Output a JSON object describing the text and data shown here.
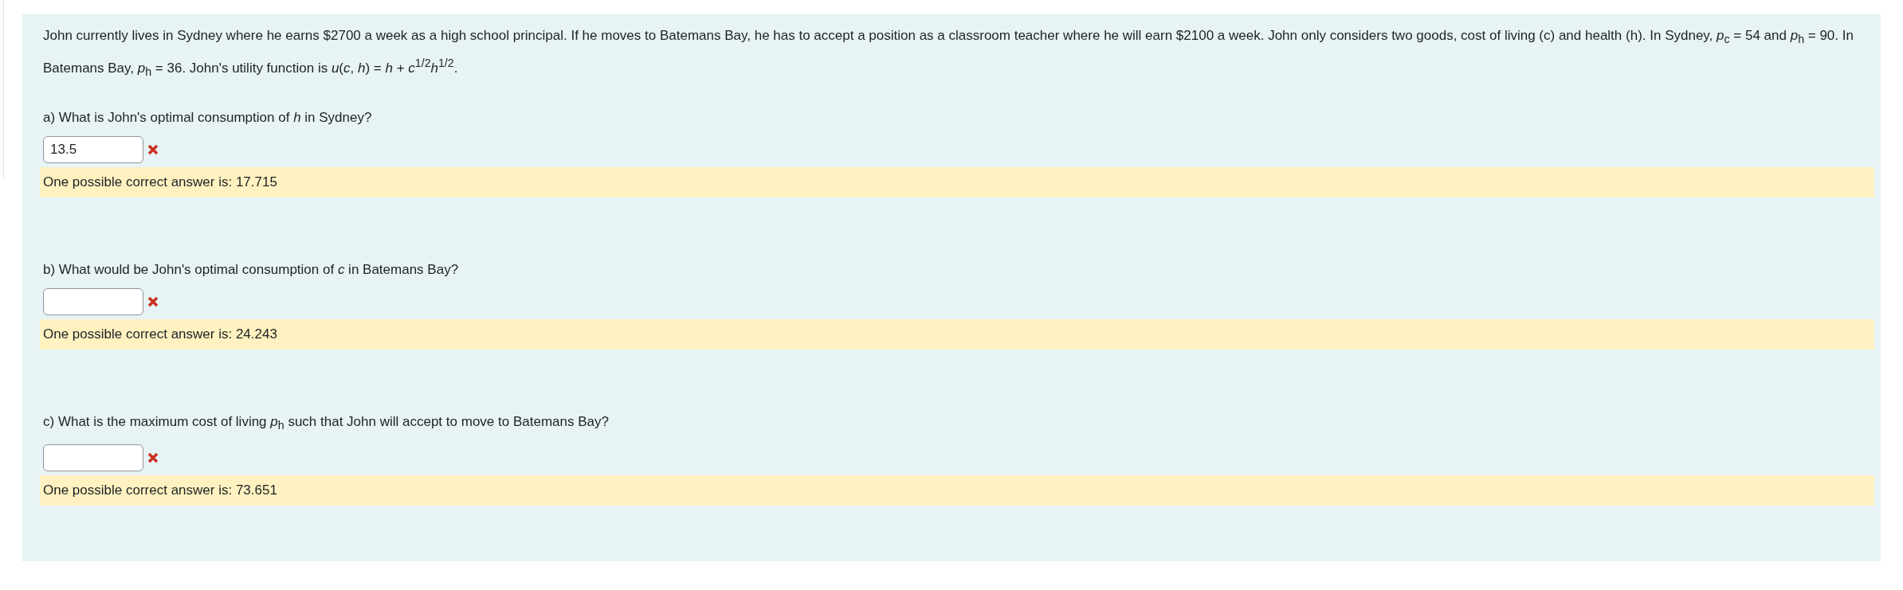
{
  "problem": {
    "text": "John currently lives in Sydney where he earns $2700 a week as a high school principal. If he moves to Batemans Bay, he has to accept a position as a classroom teacher where he will earn $2100 a week. John only considers two goods, cost of living (c) and health (h). In Sydney, *p*$_{c}$ = 54 and *p*$_{h}$ = 90. In Batemans Bay, *p*$_{h}$ = 36. John's utility function is *u*(*c*, *h*) = *h* + *c*$^{1/2}$*h*$^{1/2}$."
  },
  "questions": [
    {
      "label": "a) What is John's optimal consumption of *h* in Sydney?",
      "value": "13.5",
      "correct": false,
      "feedback": "One possible correct answer is: 17.715"
    },
    {
      "label": "b) What would be John's optimal consumption of *c* in Batemans Bay?",
      "correct": false,
      "feedback": "One possible correct answer is: 24.243"
    },
    {
      "label": "c) What is the maximum cost of living *p*$_{h}$ such that John will accept to move to Batemans Bay?",
      "correct": false,
      "feedback": "One possible correct answer is: 73.651"
    }
  ]
}
